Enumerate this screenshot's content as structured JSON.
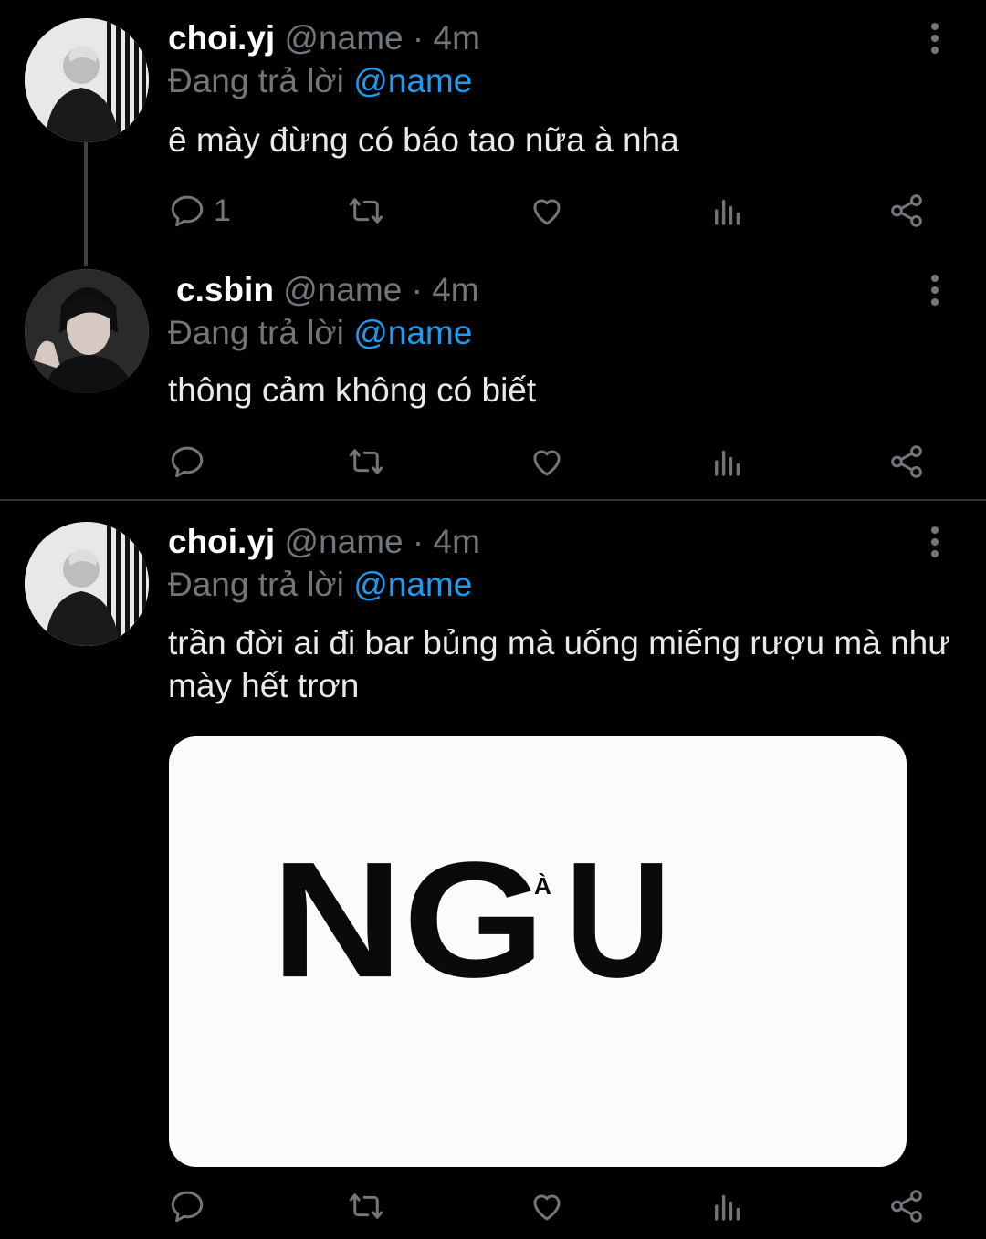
{
  "tweets": [
    {
      "display_name": "choi.yj",
      "handle": "@name",
      "separator": "·",
      "time": "4m",
      "reply_prefix": "Đang trả lời",
      "reply_to": "@name",
      "text": "ê mày đừng có báo tao nữa à nha",
      "reply_count": "1"
    },
    {
      "display_name": "c.sbin",
      "handle": "@name",
      "separator": "·",
      "time": "4m",
      "reply_prefix": "Đang trả lời",
      "reply_to": "@name",
      "text": "thông cảm không có biết",
      "reply_count": ""
    },
    {
      "display_name": "choi.yj",
      "handle": "@name",
      "separator": "·",
      "time": "4m",
      "reply_prefix": "Đang trả lời",
      "reply_to": "@name",
      "text": "trần đời ai đi bar bủng mà uống miếng rượu mà như mày hết trơn",
      "reply_count": "",
      "media_text": {
        "main_left": "NG",
        "accent": "À",
        "main_right": "U"
      }
    }
  ],
  "colors": {
    "background": "#000000",
    "muted": "#71767b",
    "mention": "#1d9bf0",
    "divider": "#2f3336"
  },
  "icons": [
    "reply-icon",
    "retweet-icon",
    "like-icon",
    "views-icon",
    "share-icon",
    "more-icon"
  ]
}
